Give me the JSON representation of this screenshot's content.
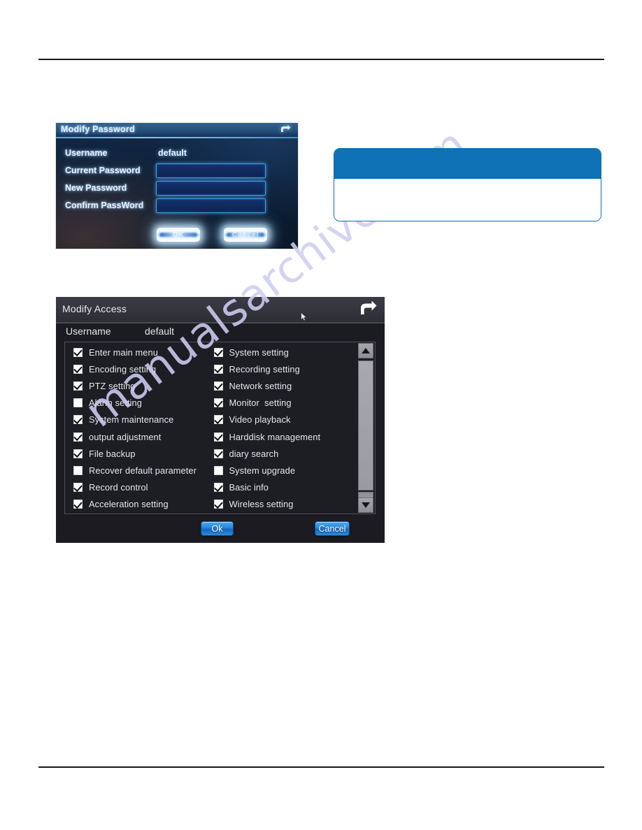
{
  "watermark": {
    "text": "manualsarchive.com"
  },
  "password_dialog": {
    "title": "Modify Password",
    "back_icon": "back-arrow-icon",
    "username_label": "Username",
    "username_value": "default",
    "current_password_label": "Current Password",
    "new_password_label": "New Password",
    "confirm_password_label": "Confirm PassWord",
    "current_password_value": "",
    "new_password_value": "",
    "confirm_password_value": "",
    "ok_label": "OK",
    "cancel_label": "Cancel",
    "colors": {
      "titlebar": "#27537e",
      "body": "#0d2038",
      "input_fill": "#102a5e",
      "input_border": "#3f9fe6"
    }
  },
  "callout": {
    "header_text": "",
    "body_text": "",
    "colors": {
      "header": "#0f71b6",
      "border": "#0f6cb0",
      "body": "#ffffff"
    }
  },
  "access_dialog": {
    "title": "Modify Access",
    "back_icon": "back-arrow-icon",
    "cursor_icon": "mouse-cursor-icon",
    "username_label": "Username",
    "username_value": "default",
    "left_column": [
      {
        "label": "Enter main menu",
        "checked": true
      },
      {
        "label": "Encoding setting",
        "checked": true
      },
      {
        "label": "PTZ setting",
        "checked": true
      },
      {
        "label": "Alarm setting",
        "checked": false
      },
      {
        "label": "System maintenance",
        "checked": true
      },
      {
        "label": "output adjustment",
        "checked": true
      },
      {
        "label": "File backup",
        "checked": true
      },
      {
        "label": "Recover default parameter",
        "checked": false
      },
      {
        "label": "Record control",
        "checked": true
      },
      {
        "label": "Acceleration setting",
        "checked": true
      }
    ],
    "right_column": [
      {
        "label": "System setting",
        "checked": true
      },
      {
        "label": "Recording setting",
        "checked": true
      },
      {
        "label": "Network setting",
        "checked": true
      },
      {
        "label": "Monitor  setting",
        "checked": true
      },
      {
        "label": "Video playback",
        "checked": true
      },
      {
        "label": "Harddisk management",
        "checked": true
      },
      {
        "label": "diary search",
        "checked": true
      },
      {
        "label": "System upgrade",
        "checked": false
      },
      {
        "label": "Basic info",
        "checked": true
      },
      {
        "label": "Wireless setting",
        "checked": true
      }
    ],
    "scroll_up_icon": "scroll-up-arrow-icon",
    "scroll_down_icon": "scroll-down-arrow-icon",
    "ok_label": "Ok",
    "cancel_label": "Cancel",
    "colors": {
      "titlebar": "#34343d",
      "body": "#1b1b21",
      "button": "#2b8bdd"
    }
  }
}
